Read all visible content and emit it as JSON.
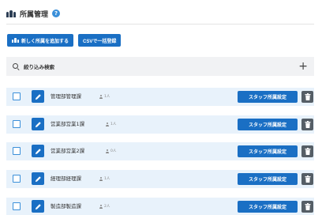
{
  "header": {
    "title": "所属管理",
    "help": "?"
  },
  "actions": {
    "add_label": "新しく所属を追加する",
    "csv_label": "CSVで一括登録"
  },
  "filter": {
    "label": "絞り込み検索",
    "add_symbol": "+"
  },
  "rows": [
    {
      "name": "管理部管理課",
      "count": "1人",
      "assign_label": "スタッフ所属設定"
    },
    {
      "name": "営業部営業1課",
      "count": "1人",
      "assign_label": "スタッフ所属設定"
    },
    {
      "name": "営業部営業2課",
      "count": "0人",
      "assign_label": "スタッフ所属設定"
    },
    {
      "name": "経理部経理課",
      "count": "1人",
      "assign_label": "スタッフ所属設定"
    },
    {
      "name": "製造部製造課",
      "count": "2人",
      "assign_label": "スタッフ所属設定"
    }
  ],
  "colors": {
    "primary": "#1a6fc4",
    "row_bg": "#e8f2fb",
    "danger_bg": "#555e66"
  }
}
